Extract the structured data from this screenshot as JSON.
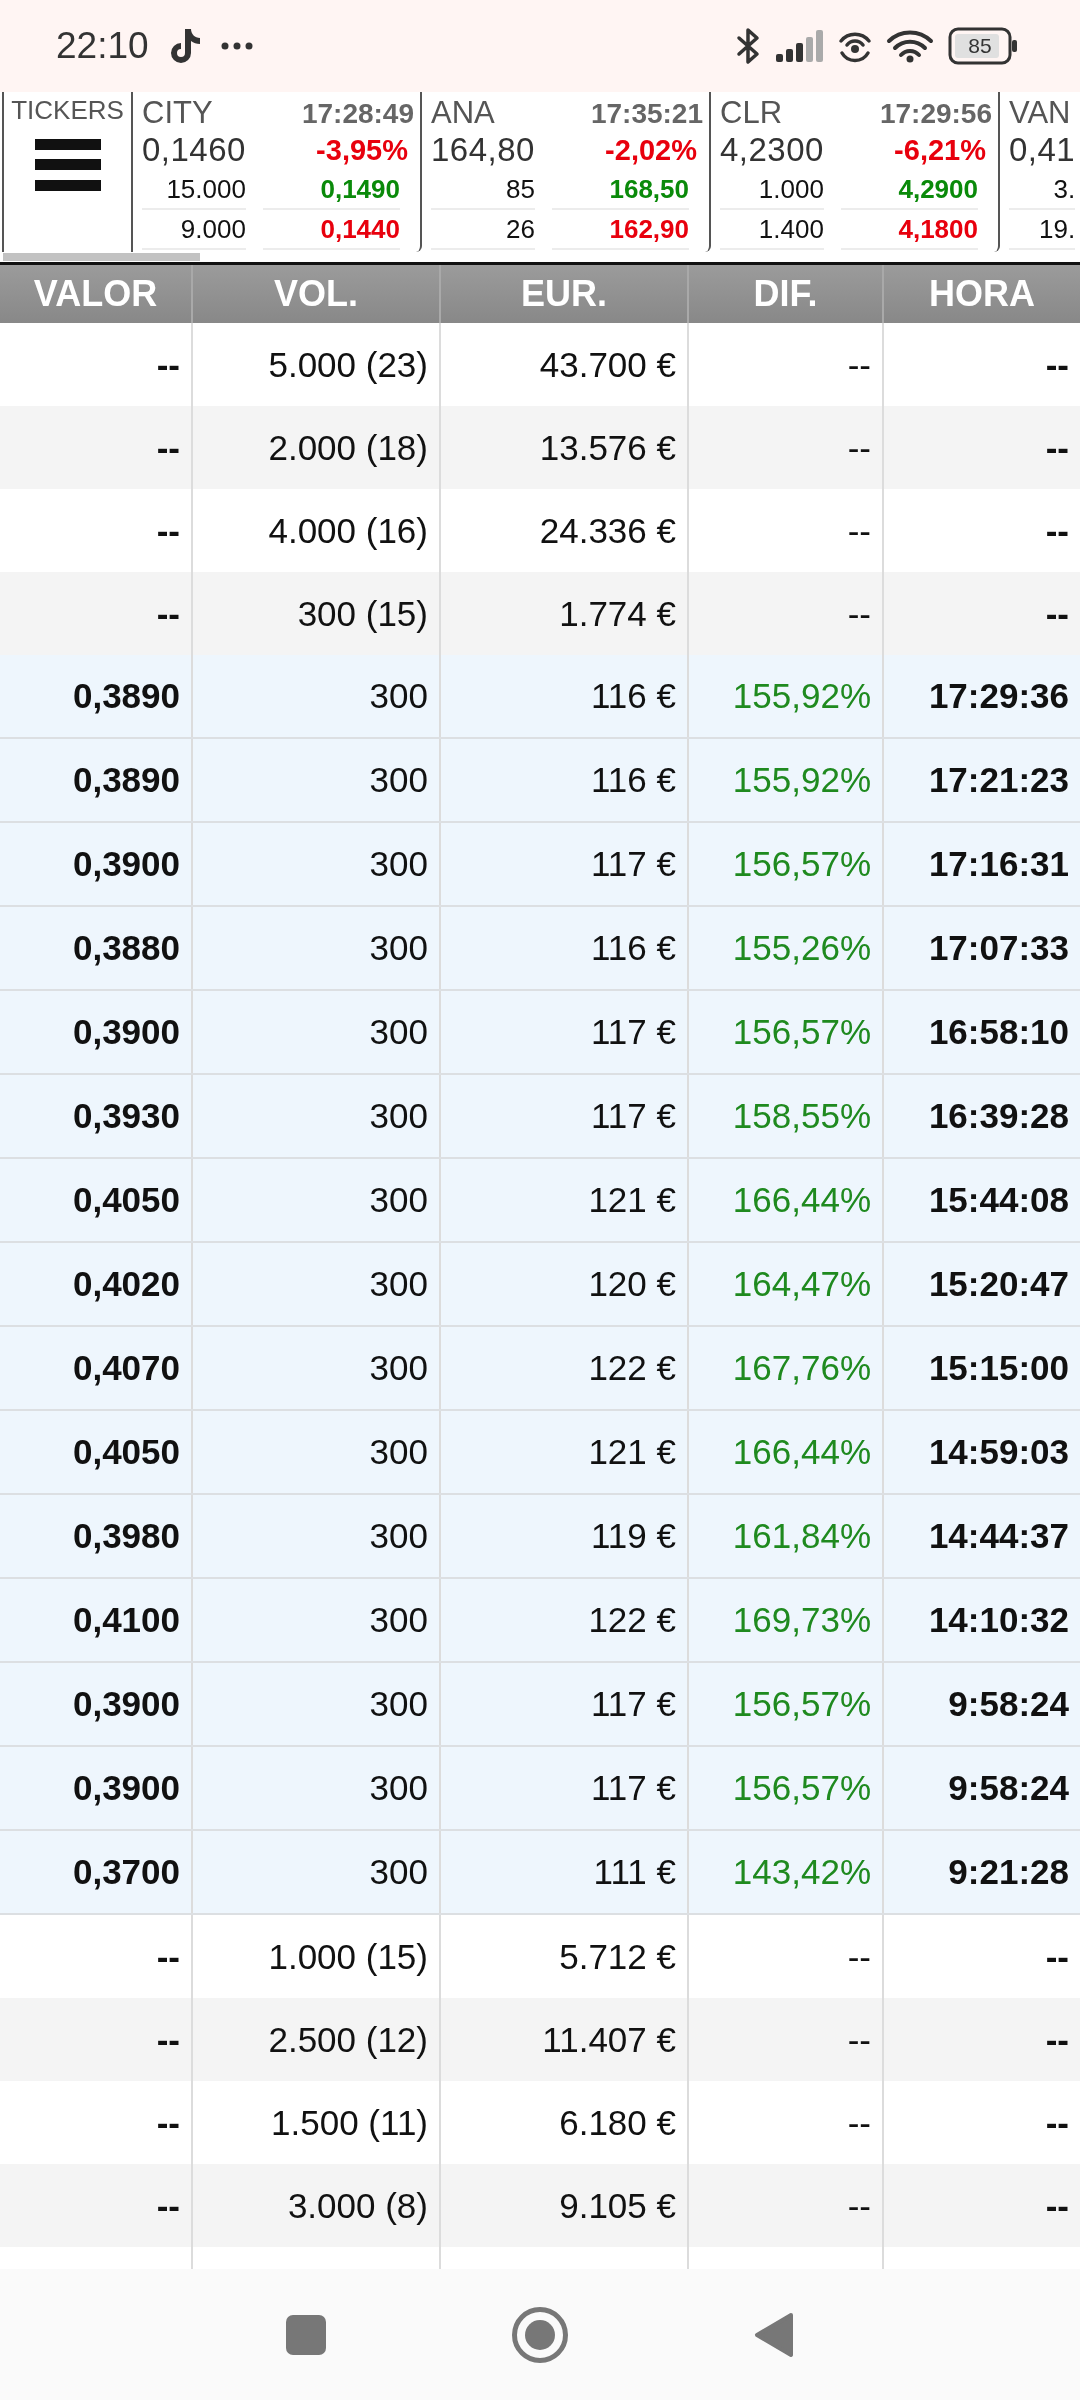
{
  "status_bar": {
    "time": "22:10",
    "battery": "85"
  },
  "tickers_panel": {
    "label": "TICKERS",
    "tickers": [
      {
        "symbol": "CITY",
        "time": "17:28:49",
        "price": "0,1460",
        "change": "-3,95%",
        "negative": true,
        "book": [
          {
            "volume": "15.000",
            "price": "0,1490",
            "color": "#0a8a0a"
          },
          {
            "volume": "9.000",
            "price": "0,1440",
            "color": "#e8000d"
          }
        ]
      },
      {
        "symbol": "ANA",
        "time": "17:35:21",
        "price": "164,80",
        "change": "-2,02%",
        "negative": true,
        "book": [
          {
            "volume": "85",
            "price": "168,50",
            "color": "#0a8a0a"
          },
          {
            "volume": "26",
            "price": "162,90",
            "color": "#e8000d"
          }
        ]
      },
      {
        "symbol": "CLR",
        "time": "17:29:56",
        "price": "4,2300",
        "change": "-6,21%",
        "negative": true,
        "book": [
          {
            "volume": "1.000",
            "price": "4,2900",
            "color": "#0a8a0a"
          },
          {
            "volume": "1.400",
            "price": "4,1800",
            "color": "#e8000d"
          }
        ]
      },
      {
        "symbol": "VAN",
        "price": "0,41",
        "book": [
          {
            "volume": "3."
          },
          {
            "volume": "19."
          }
        ]
      }
    ]
  },
  "table": {
    "columns": [
      "VALOR",
      "VOL.",
      "EUR.",
      "DIF.",
      "HORA"
    ],
    "rows": [
      {
        "kind": "aggregate",
        "cells": [
          "--",
          "5.000 (23)",
          "43.700 €",
          "--",
          "--"
        ]
      },
      {
        "kind": "aggregate",
        "cells": [
          "--",
          "2.000 (18)",
          "13.576 €",
          "--",
          "--"
        ]
      },
      {
        "kind": "aggregate",
        "cells": [
          "--",
          "4.000 (16)",
          "24.336 €",
          "--",
          "--"
        ]
      },
      {
        "kind": "aggregate",
        "cells": [
          "--",
          "300 (15)",
          "1.774 €",
          "--",
          "--"
        ]
      },
      {
        "kind": "trade",
        "cells": [
          "0,3890",
          "300",
          "116 €",
          "155,92%",
          "17:29:36"
        ]
      },
      {
        "kind": "trade",
        "cells": [
          "0,3890",
          "300",
          "116 €",
          "155,92%",
          "17:21:23"
        ]
      },
      {
        "kind": "trade",
        "cells": [
          "0,3900",
          "300",
          "117 €",
          "156,57%",
          "17:16:31"
        ]
      },
      {
        "kind": "trade",
        "cells": [
          "0,3880",
          "300",
          "116 €",
          "155,26%",
          "17:07:33"
        ]
      },
      {
        "kind": "trade",
        "cells": [
          "0,3900",
          "300",
          "117 €",
          "156,57%",
          "16:58:10"
        ]
      },
      {
        "kind": "trade",
        "cells": [
          "0,3930",
          "300",
          "117 €",
          "158,55%",
          "16:39:28"
        ]
      },
      {
        "kind": "trade",
        "cells": [
          "0,4050",
          "300",
          "121 €",
          "166,44%",
          "15:44:08"
        ]
      },
      {
        "kind": "trade",
        "cells": [
          "0,4020",
          "300",
          "120 €",
          "164,47%",
          "15:20:47"
        ]
      },
      {
        "kind": "trade",
        "cells": [
          "0,4070",
          "300",
          "122 €",
          "167,76%",
          "15:15:00"
        ]
      },
      {
        "kind": "trade",
        "cells": [
          "0,4050",
          "300",
          "121 €",
          "166,44%",
          "14:59:03"
        ]
      },
      {
        "kind": "trade",
        "cells": [
          "0,3980",
          "300",
          "119 €",
          "161,84%",
          "14:44:37"
        ]
      },
      {
        "kind": "trade",
        "cells": [
          "0,4100",
          "300",
          "122 €",
          "169,73%",
          "14:10:32"
        ]
      },
      {
        "kind": "trade",
        "cells": [
          "0,3900",
          "300",
          "117 €",
          "156,57%",
          "9:58:24"
        ]
      },
      {
        "kind": "trade",
        "cells": [
          "0,3900",
          "300",
          "117 €",
          "156,57%",
          "9:58:24"
        ]
      },
      {
        "kind": "trade",
        "cells": [
          "0,3700",
          "300",
          "111 €",
          "143,42%",
          "9:21:28"
        ]
      },
      {
        "kind": "aggregate",
        "cells": [
          "--",
          "1.000 (15)",
          "5.712 €",
          "--",
          "--"
        ]
      },
      {
        "kind": "aggregate",
        "cells": [
          "--",
          "2.500 (12)",
          "11.407 €",
          "--",
          "--"
        ]
      },
      {
        "kind": "aggregate",
        "cells": [
          "--",
          "1.500 (11)",
          "6.180 €",
          "--",
          "--"
        ]
      },
      {
        "kind": "aggregate",
        "cells": [
          "--",
          "3.000 (8)",
          "9.105 €",
          "--",
          "--"
        ]
      }
    ]
  }
}
